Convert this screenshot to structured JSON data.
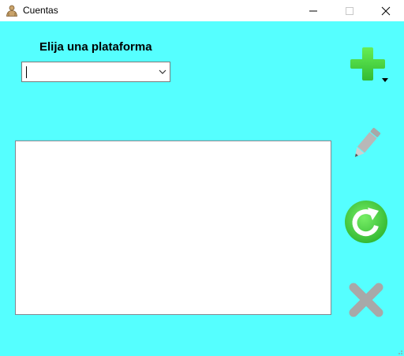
{
  "window": {
    "title": "Cuentas",
    "app_icon": "person-icon",
    "controls": [
      "minimize-icon",
      "maximize-icon",
      "close-icon"
    ]
  },
  "form": {
    "prompt_label": "Elija una plataforma",
    "platform_combo": {
      "selected_value": "",
      "icon": "chevron-down-icon"
    },
    "accounts_list": {
      "items": []
    }
  },
  "toolbar": {
    "buttons": [
      {
        "name": "add",
        "icon": "plus-icon",
        "color": "#44dd44",
        "has_dropdown": true
      },
      {
        "name": "edit",
        "icon": "pencil-icon",
        "color": "#a0a0a0"
      },
      {
        "name": "refresh",
        "icon": "refresh-icon",
        "color": "#44dd44"
      },
      {
        "name": "delete",
        "icon": "x-icon",
        "color": "#a8a8a8"
      }
    ]
  },
  "colors": {
    "client_background": "#55ffff",
    "accent_green": "#44dd44",
    "disabled_gray": "#a8a8a8"
  }
}
